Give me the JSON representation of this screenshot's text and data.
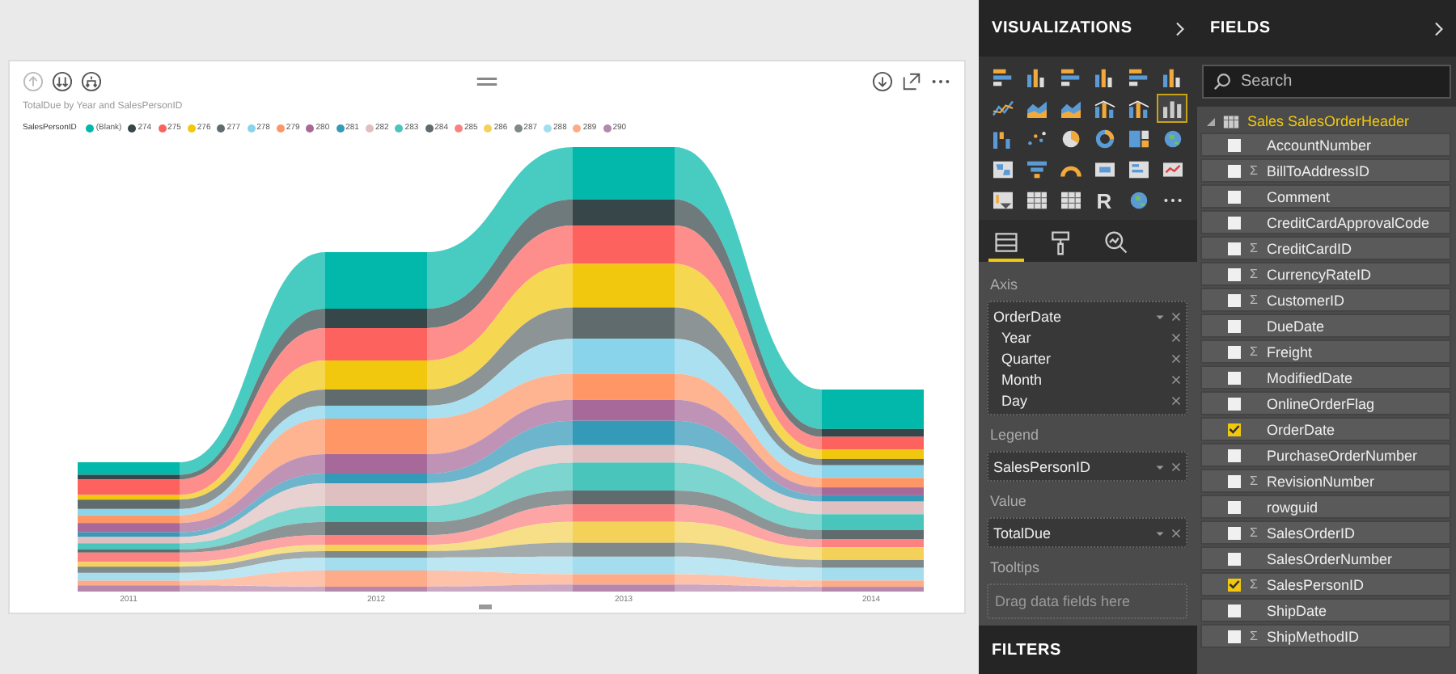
{
  "visual": {
    "title": "TotalDue by Year and SalesPersonID",
    "legend_title": "SalesPersonID",
    "legend": [
      {
        "label": "(Blank)",
        "color": "#01b8aa"
      },
      {
        "label": "274",
        "color": "#374649"
      },
      {
        "label": "275",
        "color": "#fd625e"
      },
      {
        "label": "276",
        "color": "#f2c80f"
      },
      {
        "label": "277",
        "color": "#5f6b6d"
      },
      {
        "label": "278",
        "color": "#8ad4eb"
      },
      {
        "label": "279",
        "color": "#fe9666"
      },
      {
        "label": "280",
        "color": "#a66999"
      },
      {
        "label": "281",
        "color": "#3599b8"
      },
      {
        "label": "282",
        "color": "#dfbfbf"
      },
      {
        "label": "283",
        "color": "#4ac5bb"
      },
      {
        "label": "284",
        "color": "#5f6b6d"
      },
      {
        "label": "285",
        "color": "#fb8281"
      },
      {
        "label": "286",
        "color": "#f4d25a"
      },
      {
        "label": "287",
        "color": "#7f898a"
      },
      {
        "label": "288",
        "color": "#a4ddee"
      },
      {
        "label": "289",
        "color": "#fdab89"
      },
      {
        "label": "290",
        "color": "#b687ac"
      }
    ],
    "x_labels": [
      "2011",
      "2012",
      "2013",
      "2014"
    ]
  },
  "visualizations": {
    "title": "VISUALIZATIONS",
    "types": [
      {
        "kind": "hbar",
        "selected": false
      },
      {
        "kind": "column",
        "selected": false
      },
      {
        "kind": "hbar",
        "selected": false
      },
      {
        "kind": "column",
        "selected": false
      },
      {
        "kind": "hbar",
        "selected": false
      },
      {
        "kind": "column",
        "selected": false
      },
      {
        "kind": "line",
        "selected": false
      },
      {
        "kind": "area",
        "selected": false
      },
      {
        "kind": "area",
        "selected": false
      },
      {
        "kind": "combo",
        "selected": false
      },
      {
        "kind": "combo",
        "selected": false
      },
      {
        "kind": "ribbon",
        "selected": true
      },
      {
        "kind": "waterfall",
        "selected": false
      },
      {
        "kind": "scatter",
        "selected": false
      },
      {
        "kind": "pie",
        "selected": false
      },
      {
        "kind": "donut",
        "selected": false
      },
      {
        "kind": "treemap",
        "selected": false
      },
      {
        "kind": "globe",
        "selected": false
      },
      {
        "kind": "map",
        "selected": false
      },
      {
        "kind": "funnel",
        "selected": false
      },
      {
        "kind": "gauge",
        "selected": false
      },
      {
        "kind": "card",
        "selected": false
      },
      {
        "kind": "multirow",
        "selected": false
      },
      {
        "kind": "kpi",
        "selected": false
      },
      {
        "kind": "slicer",
        "selected": false
      },
      {
        "kind": "table",
        "selected": false
      },
      {
        "kind": "table",
        "selected": false
      },
      {
        "kind": "r",
        "label": "R",
        "selected": false
      },
      {
        "kind": "globe",
        "selected": false
      },
      {
        "kind": "more",
        "selected": false
      }
    ],
    "pane_tabs": [
      {
        "kind": "fields",
        "selected": true
      },
      {
        "kind": "format",
        "selected": false
      },
      {
        "kind": "analytics",
        "selected": false
      }
    ],
    "wells": [
      {
        "label": "Axis",
        "fields": [
          {
            "name": "OrderDate",
            "children": [
              {
                "name": "Year"
              },
              {
                "name": "Quarter"
              },
              {
                "name": "Month"
              },
              {
                "name": "Day"
              }
            ]
          }
        ]
      },
      {
        "label": "Legend",
        "fields": [
          {
            "name": "SalesPersonID"
          }
        ]
      },
      {
        "label": "Value",
        "fields": [
          {
            "name": "TotalDue"
          }
        ]
      },
      {
        "label": "Tooltips",
        "placeholder": "Drag data fields here"
      }
    ]
  },
  "filters": {
    "title": "FILTERS"
  },
  "fields": {
    "title": "FIELDS",
    "search": {
      "placeholder": "Search"
    },
    "table": {
      "name": "Sales SalesOrderHeader",
      "expanded": true,
      "children": [
        {
          "name": "AccountNumber",
          "checked": false
        },
        {
          "name": "BillToAddressID",
          "icon": "Σ",
          "checked": false
        },
        {
          "name": "Comment",
          "checked": false
        },
        {
          "name": "CreditCardApprovalCode",
          "checked": false
        },
        {
          "name": "CreditCardID",
          "icon": "Σ",
          "checked": false
        },
        {
          "name": "CurrencyRateID",
          "icon": "Σ",
          "checked": false
        },
        {
          "name": "CustomerID",
          "icon": "Σ",
          "checked": false
        },
        {
          "name": "DueDate",
          "checked": false
        },
        {
          "name": "Freight",
          "icon": "Σ",
          "checked": false
        },
        {
          "name": "ModifiedDate",
          "checked": false
        },
        {
          "name": "OnlineOrderFlag",
          "checked": false
        },
        {
          "name": "OrderDate",
          "checked": true
        },
        {
          "name": "PurchaseOrderNumber",
          "checked": false
        },
        {
          "name": "RevisionNumber",
          "icon": "Σ",
          "checked": false
        },
        {
          "name": "rowguid",
          "checked": false
        },
        {
          "name": "SalesOrderID",
          "icon": "Σ",
          "checked": false
        },
        {
          "name": "SalesOrderNumber",
          "checked": false
        },
        {
          "name": "SalesPersonID",
          "icon": "Σ",
          "checked": true
        },
        {
          "name": "ShipDate",
          "checked": false
        },
        {
          "name": "ShipMethodID",
          "icon": "Σ",
          "checked": false
        }
      ]
    }
  }
}
